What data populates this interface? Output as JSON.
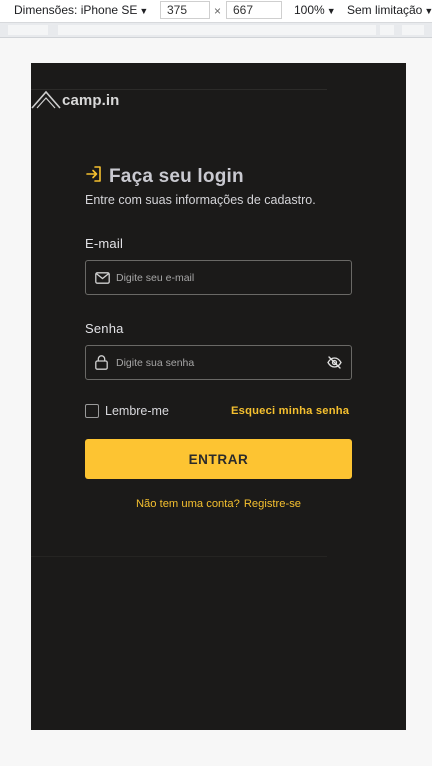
{
  "devtools": {
    "dimensions_label": "Dimensões: iPhone SE",
    "width": "375",
    "times": "×",
    "height": "667",
    "zoom": "100%",
    "throttle": "Sem limitação"
  },
  "brand": {
    "name": "camp.in"
  },
  "login": {
    "title": "Faça seu login",
    "subtitle": "Entre com suas informações de cadastro.",
    "email_label": "E-mail",
    "email_placeholder": "Digite seu e-mail",
    "password_label": "Senha",
    "password_placeholder": "Digite sua senha",
    "remember_label": "Lembre-me",
    "forgot_link": "Esqueci minha senha",
    "submit_label": "ENTRAR",
    "signup_prompt": "Não tem uma conta?",
    "signup_link": "Registre-se"
  },
  "colors": {
    "background": "#1b1a19",
    "accent": "#fdc432",
    "text": "#d4d4d8"
  }
}
